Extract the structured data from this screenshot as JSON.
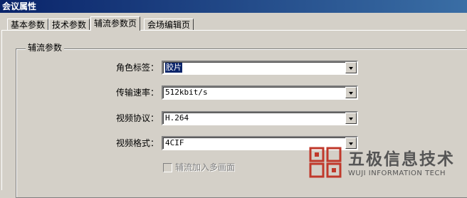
{
  "window": {
    "title": "会议属性"
  },
  "tabs": [
    {
      "label": "基本参数",
      "active": false
    },
    {
      "label": "技术参数",
      "active": false
    },
    {
      "label": "辅流参数页",
      "active": true
    },
    {
      "label": "会场编辑页",
      "active": false
    }
  ],
  "group": {
    "title": "辅流参数",
    "fields": [
      {
        "label": "角色标签：",
        "value": "胶片",
        "highlighted": true
      },
      {
        "label": "传输速率：",
        "value": "512kbit/s",
        "highlighted": false
      },
      {
        "label": "视频协议：",
        "value": "H.264",
        "highlighted": false
      },
      {
        "label": "视频格式：",
        "value": "4CIF",
        "highlighted": false
      }
    ],
    "checkbox": {
      "label": "辅流加入多画面",
      "checked": false,
      "enabled": false
    }
  },
  "watermark": {
    "text": "五极信息技术",
    "subtext": "WUJI INFORMATION TECH",
    "color": "#c0392b"
  }
}
